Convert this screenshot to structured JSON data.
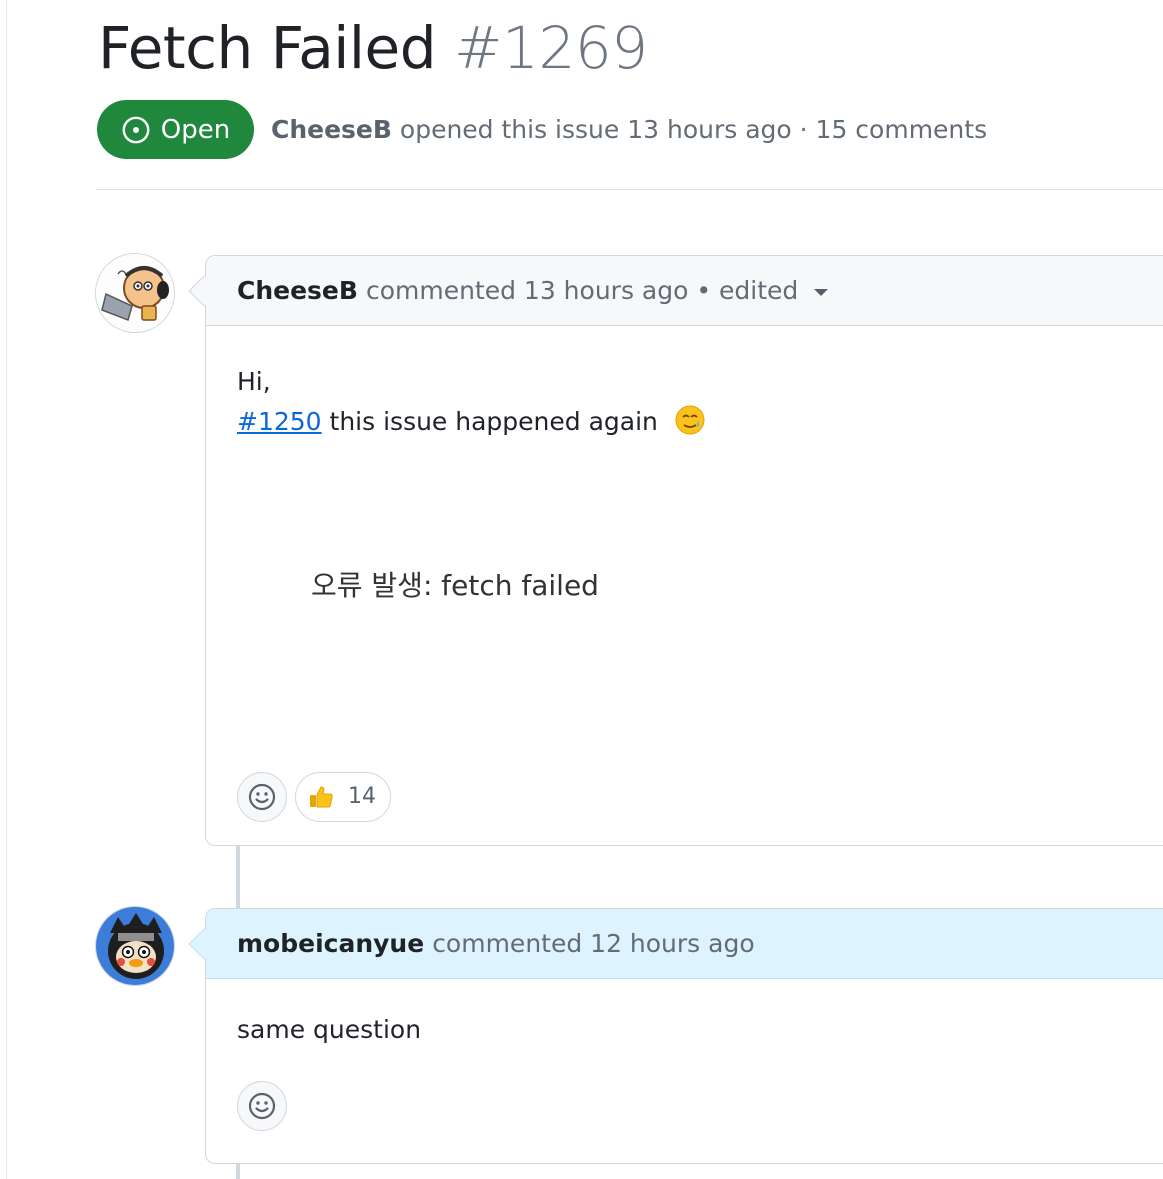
{
  "issue": {
    "title": "Fetch Failed",
    "number": "#1269",
    "state_label": "Open",
    "author": "CheeseB",
    "meta_text": "opened this issue 13 hours ago · 15 comments",
    "state_color": "#1f883d"
  },
  "comments": [
    {
      "author": "CheeseB",
      "meta": "commented 13 hours ago • edited",
      "body_line1": "Hi,",
      "issue_link": "#1250",
      "body_line2": "this issue happened again",
      "emoji": "smiling-face-with-tear",
      "image_text": "오류 발생: fetch failed",
      "reaction_emoji": "thumbs-up",
      "reaction_count": "14"
    },
    {
      "author": "mobeicanyue",
      "meta": "commented 12 hours ago",
      "body": "same question"
    }
  ],
  "icons": [
    "issue-opened-icon",
    "smiley-icon",
    "thumbs-up-icon",
    "caret-down-icon"
  ]
}
